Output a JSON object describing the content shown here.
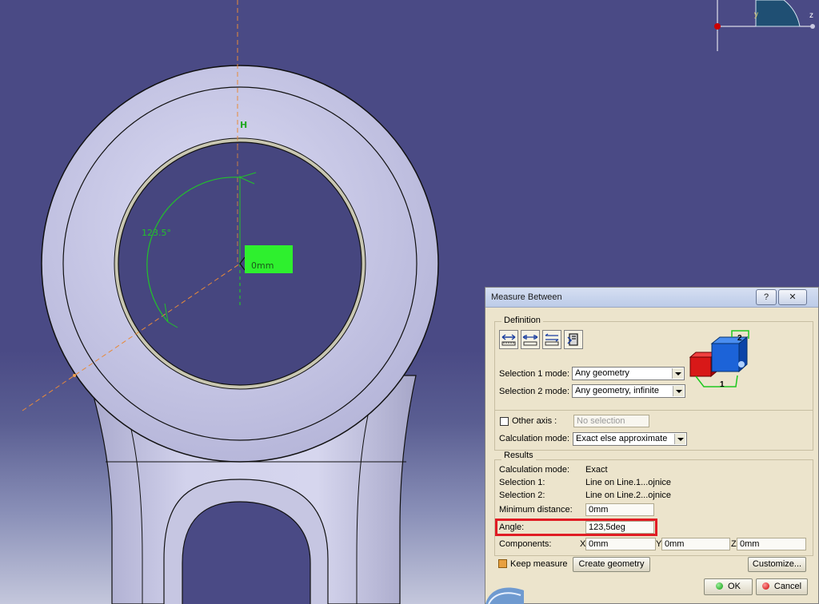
{
  "viewport": {
    "angle_annotation": "123.5°",
    "distance_annotation": "0mm",
    "plane_label": "H",
    "compass_labels": [
      "y",
      "z"
    ]
  },
  "dialog": {
    "title": "Measure Between",
    "help_label": "?",
    "close_label": "✕",
    "definition": {
      "legend": "Definition",
      "selection1_label": "Selection 1 mode:",
      "selection1_value": "Any geometry",
      "selection2_label": "Selection 2 mode:",
      "selection2_value": "Any geometry, infinite",
      "other_axis_label": "Other axis :",
      "other_axis_value": "No selection",
      "calc_mode_label": "Calculation mode:",
      "calc_mode_value": "Exact else approximate",
      "preview_labels": [
        "2",
        "1"
      ]
    },
    "results": {
      "legend": "Results",
      "calc_mode_label": "Calculation mode:",
      "calc_mode_value": "Exact",
      "selection1_label": "Selection 1:",
      "selection1_value": "Line on Line.1...ojnice",
      "selection2_label": "Selection 2:",
      "selection2_value": "Line on Line.2...ojnice",
      "min_distance_label": "Minimum distance:",
      "min_distance_value": "0mm",
      "angle_label": "Angle:",
      "angle_value": "123,5deg",
      "components_label": "Components:",
      "x_label": "X",
      "x_value": "0mm",
      "y_label": "Y",
      "y_value": "0mm",
      "z_label": "Z",
      "z_value": "0mm"
    },
    "keep_measure_label": "Keep measure",
    "create_geometry_label": "Create geometry",
    "customize_label": "Customize...",
    "ok_label": "OK",
    "cancel_label": "Cancel"
  },
  "colors": {
    "background": "#4a4a85",
    "part": "#cfcfeb",
    "measure_green": "#22c22a",
    "axis_orange": "#e88a3a",
    "highlight_red": "#e01c24"
  }
}
